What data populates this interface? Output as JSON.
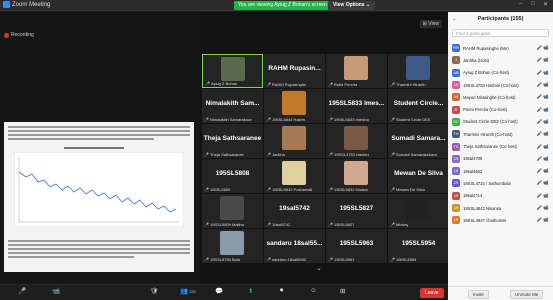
{
  "window": {
    "app_title": "Zoom Meeting"
  },
  "banner": {
    "share_text": "You are viewing Ayiug Z Bohan's screen",
    "view_options": "View Options ⌄"
  },
  "share": {
    "recording_label": "Recording"
  },
  "grid": {
    "view_label": "⊞ View",
    "tiles": [
      {
        "name": "",
        "label": "Ayiug Z Bohan",
        "photo": "#5a6a50",
        "active": true
      },
      {
        "name": "RAHM Rupasin...",
        "label": "RAHM Rupasinghe",
        "photo": ""
      },
      {
        "name": "",
        "label": "Ruthi Pereira",
        "photo": "#c79a7a"
      },
      {
        "name": "",
        "label": "Tharmini Hiranth",
        "photo": "#405a88"
      },
      {
        "name": "Nimalakith Sam...",
        "label": "Nimalakith Samarakoon",
        "photo": ""
      },
      {
        "name": "",
        "label": "195SL6844 Hazim",
        "photo": "#c07a2a"
      },
      {
        "name": "195SL5833 Imes...",
        "label": "195SL5833 Imesha",
        "photo": ""
      },
      {
        "name": "Student Circle...",
        "label": "Student Circle DES",
        "photo": ""
      },
      {
        "name": "Theja Sathsaranee",
        "label": "Theja Sathsaranee",
        "photo": ""
      },
      {
        "name": "",
        "label": "Janitha",
        "photo": "#a57a55"
      },
      {
        "name": "",
        "label": "19SSL4753 Hashini",
        "photo": "#7a5a44"
      },
      {
        "name": "Sumadi Samara...",
        "label": "Sumadi Samarasekara",
        "photo": ""
      },
      {
        "name": "195SL5808",
        "label": "195SL5808",
        "photo": ""
      },
      {
        "name": "",
        "label": "195SL5832 Poshamali",
        "photo": "#e0d0a0"
      },
      {
        "name": "",
        "label": "195SL5832 Kisaka",
        "photo": "#d0a890"
      },
      {
        "name": "Mewan De Silva",
        "label": "Mewan De Silva",
        "photo": ""
      },
      {
        "name": "",
        "label": "19SSL5809 Maltha",
        "photo": "#4a4a4a"
      },
      {
        "name": "19sal5742",
        "label": "19sal5742",
        "photo": ""
      },
      {
        "name": "195SL5827",
        "label": "195SL5827",
        "photo": ""
      },
      {
        "name": "",
        "label": "Mickey",
        "photo": "#222222"
      },
      {
        "name": "",
        "label": "19SSL5750 Bola",
        "photo": "#8a9aaa"
      },
      {
        "name": "sandaru 18sal55...",
        "label": "sandaru 18sal5592",
        "photo": ""
      },
      {
        "name": "195SL5963",
        "label": "195SL5963",
        "photo": ""
      },
      {
        "name": "195SL5954",
        "label": "195SL5954",
        "photo": ""
      }
    ]
  },
  "panel": {
    "title": "Participants (155)",
    "search_placeholder": "Find a participant",
    "participants": [
      {
        "initials": "RR",
        "name": "RAHM Rupasinghe (Me)",
        "color": "#3b6ed8"
      },
      {
        "initials": "J",
        "name": "Janitha (Host)",
        "color": "#8a6a55"
      },
      {
        "initials": "AB",
        "name": "Ayiug Z Bohan (Co-host)",
        "color": "#3b6ed8"
      },
      {
        "initials": "19",
        "name": "19SSL4753 Hashini (Co-host)",
        "color": "#e05aa0"
      },
      {
        "initials": "M",
        "name": "Mayuri Nirasinghe (Co-host)",
        "color": "#d06a2a"
      },
      {
        "initials": "R",
        "name": "Pooni Pereira (Co-host)",
        "color": "#c0504d"
      },
      {
        "initials": "SC",
        "name": "Student Circle DES (Co-host)",
        "color": "#3cae4e"
      },
      {
        "initials": "TH",
        "name": "Tharmini Hiranth (Co-host)",
        "color": "#405a88"
      },
      {
        "initials": "TS",
        "name": "Theja Sathsaranee (Co-host)",
        "color": "#9b59b6"
      },
      {
        "initials": "19",
        "name": "19sal4706",
        "color": "#8e6bbf"
      },
      {
        "initials": "19",
        "name": "19sal4662",
        "color": "#7a6bcf"
      },
      {
        "initials": "19",
        "name": "19SSL4724 / Sathumbala",
        "color": "#6a5acd"
      },
      {
        "initials": "19",
        "name": "19sal4714",
        "color": "#c0504d"
      },
      {
        "initials": "19",
        "name": "19SSL4843 Nisansa",
        "color": "#d0942a"
      },
      {
        "initials": "19",
        "name": "19SSL4847 chathumini",
        "color": "#e07b2a"
      }
    ],
    "invite_label": "Invite",
    "unmute_label": "Unmute Me"
  },
  "toolbar": {
    "unmute": "🎤",
    "video": "📹",
    "security": "🛡",
    "participants": "👥",
    "participants_count": "155",
    "chat": "💬",
    "share": "⬆",
    "record": "⏺",
    "reactions": "☺",
    "apps": "⊞",
    "leave": "Leave"
  }
}
